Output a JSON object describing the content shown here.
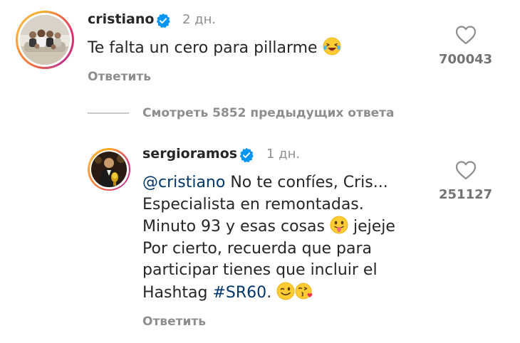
{
  "comments": [
    {
      "username": "cristiano",
      "time_ago": "2 дн.",
      "text": "Te falta un cero para pillarme",
      "emoji": "laughing-tears",
      "reply_label": "Ответить",
      "likes": "700043"
    },
    {
      "username": "sergioramos",
      "time_ago": "1 дн.",
      "mention": "@cristiano",
      "line1_rest": " No te confíes, Cris...",
      "line2": "Especialista en remontadas.",
      "line3_pre": "Minuto 93 y esas cosas",
      "line3_post": " jejeje",
      "line4": "Por cierto, recuerda que para",
      "line5": "participar tienes que incluir el",
      "line6_pre": "Hashtag ",
      "hashtag": "#SR60",
      "line6_post": ".",
      "reply_label": "Ответить",
      "likes": "251127"
    }
  ],
  "view_more_label": "Смотреть 5852 предыдущих ответа",
  "colors": {
    "text": "#262626",
    "secondary": "#8e8e8e",
    "link": "#00376b",
    "verified": "#0095f6"
  }
}
